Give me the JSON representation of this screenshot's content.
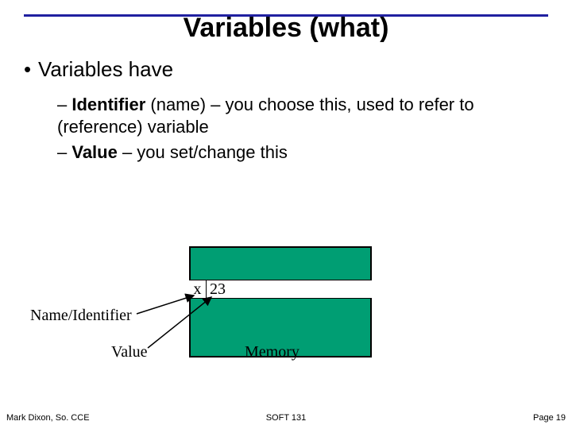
{
  "title": "Variables (what)",
  "bullet1": "Variables have",
  "sub1": {
    "dash": "– ",
    "bold": "Identifier",
    "rest": " (name) – you choose this, used to refer to (reference) variable"
  },
  "sub2": {
    "dash": "– ",
    "bold": "Value",
    "rest": " – you set/change this"
  },
  "diagram": {
    "varName": "x",
    "varValue": "23",
    "labelNameId": "Name/Identifier",
    "labelValue": "Value",
    "labelMemory": "Memory"
  },
  "footer": {
    "left": "Mark Dixon, So. CCE",
    "center": "SOFT 131",
    "right": "Page 19"
  }
}
